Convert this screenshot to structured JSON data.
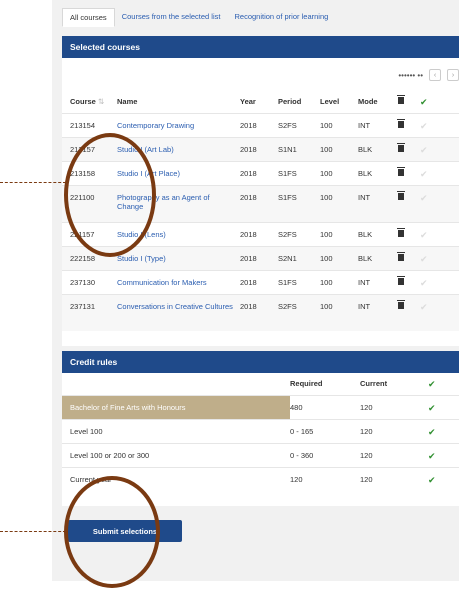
{
  "tabs": [
    "All courses",
    "Courses from the selected list",
    "Recognition of prior learning"
  ],
  "selected": {
    "title": "Selected courses",
    "pager": "•••••• ••",
    "columns": [
      "Course",
      "Name",
      "Year",
      "Period",
      "Level",
      "Mode"
    ],
    "rows": [
      {
        "code": "213154",
        "name": "Contemporary Drawing",
        "year": "2018",
        "period": "S2FS",
        "level": "100",
        "mode": "INT"
      },
      {
        "code": "213157",
        "name": "Studio I (Art Lab)",
        "year": "2018",
        "period": "S1N1",
        "level": "100",
        "mode": "BLK"
      },
      {
        "code": "213158",
        "name": "Studio I (Art Place)",
        "year": "2018",
        "period": "S1FS",
        "level": "100",
        "mode": "BLK"
      },
      {
        "code": "221100",
        "name": "Photography as an Agent of Change",
        "year": "2018",
        "period": "S1FS",
        "level": "100",
        "mode": "INT"
      },
      {
        "code": "221157",
        "name": "Studio I (Lens)",
        "year": "2018",
        "period": "S2FS",
        "level": "100",
        "mode": "BLK"
      },
      {
        "code": "222158",
        "name": "Studio I (Type)",
        "year": "2018",
        "period": "S2N1",
        "level": "100",
        "mode": "BLK"
      },
      {
        "code": "237130",
        "name": "Communication for Makers",
        "year": "2018",
        "period": "S1FS",
        "level": "100",
        "mode": "INT"
      },
      {
        "code": "237131",
        "name": "Conversations in Creative Cultures",
        "year": "2018",
        "period": "S2FS",
        "level": "100",
        "mode": "INT"
      }
    ]
  },
  "credit": {
    "title": "Credit rules",
    "columns": [
      "Required",
      "Current"
    ],
    "rows": [
      {
        "rule": "Bachelor of Fine Arts with Honours",
        "required": "480",
        "current": "120"
      },
      {
        "rule": "Level 100",
        "required": "0 - 165",
        "current": "120"
      },
      {
        "rule": "Level 100 or 200 or 300",
        "required": "0 - 360",
        "current": "120"
      },
      {
        "rule": "Current year",
        "required": "120",
        "current": "120"
      }
    ]
  },
  "submit_label": "Submit selections",
  "icons": {
    "delete": "trash-icon",
    "status": "check-icon",
    "sort": "sort-icon"
  },
  "colors": {
    "header": "#1f4a8a",
    "link": "#2a5db0",
    "check": "#2f8f2f",
    "highlight": "#bfae8a",
    "annotation": "#7a3a12"
  }
}
